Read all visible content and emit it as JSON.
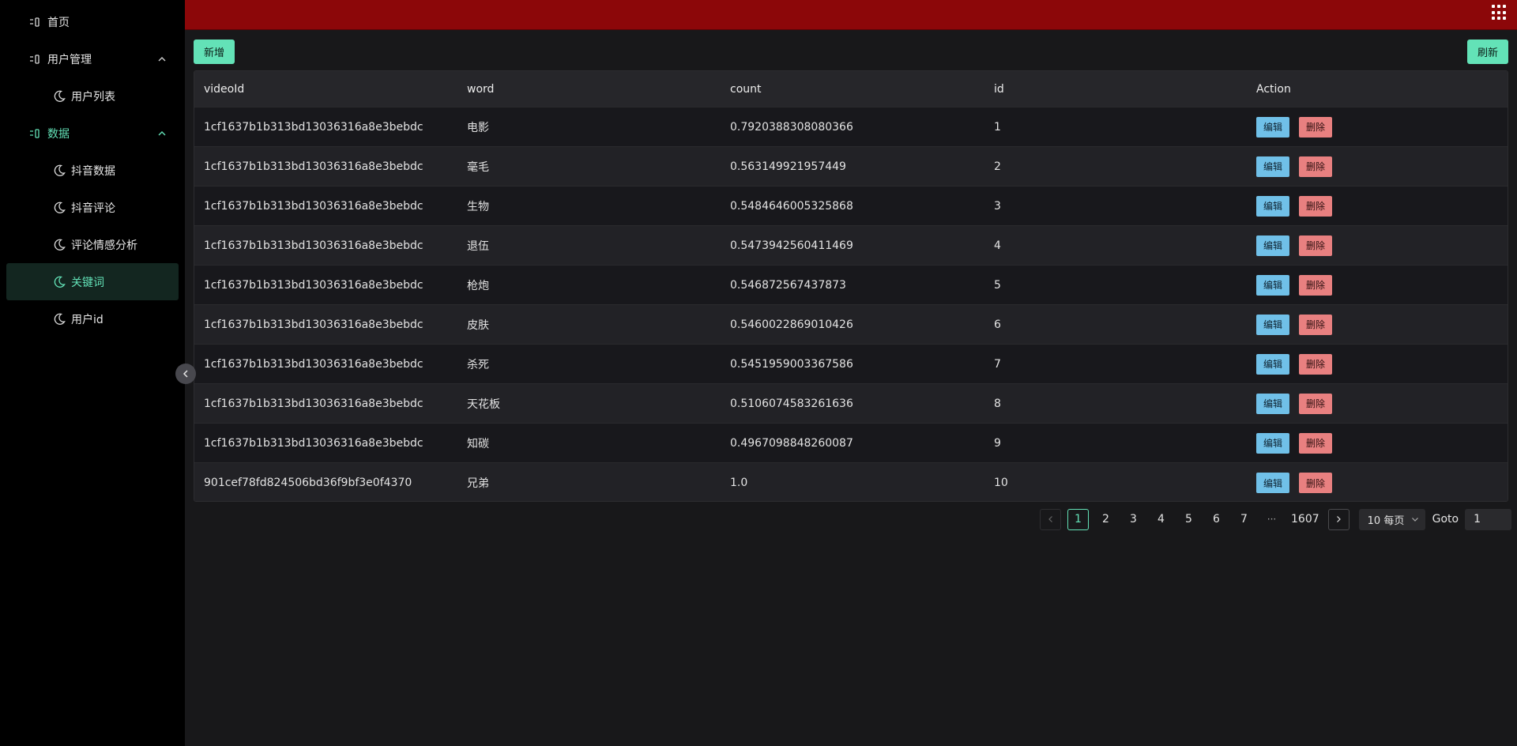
{
  "sidebar": {
    "items": [
      {
        "label": "首页",
        "icon": "menu-icon",
        "level": 0
      },
      {
        "label": "用户管理",
        "icon": "menu-icon",
        "level": 0,
        "expandable": true
      },
      {
        "label": "用户列表",
        "icon": "moon-icon",
        "level": 1
      },
      {
        "label": "数据",
        "icon": "menu-icon",
        "level": 0,
        "expandable": true,
        "open": true
      },
      {
        "label": "抖音数据",
        "icon": "moon-icon",
        "level": 1
      },
      {
        "label": "抖音评论",
        "icon": "moon-icon",
        "level": 1
      },
      {
        "label": "评论情感分析",
        "icon": "moon-icon",
        "level": 1
      },
      {
        "label": "关键词",
        "icon": "moon-icon",
        "level": 1,
        "active": true
      },
      {
        "label": "用户id",
        "icon": "moon-icon",
        "level": 1
      }
    ]
  },
  "toolbar": {
    "add_label": "新增",
    "refresh_label": "刷新"
  },
  "table": {
    "columns": [
      "videoId",
      "word",
      "count",
      "id",
      "Action"
    ],
    "rows": [
      [
        "1cf1637b1b313bd13036316a8e3bebdc",
        "电影",
        "0.7920388308080366",
        "1"
      ],
      [
        "1cf1637b1b313bd13036316a8e3bebdc",
        "毫毛",
        "0.563149921957449",
        "2"
      ],
      [
        "1cf1637b1b313bd13036316a8e3bebdc",
        "生物",
        "0.5484646005325868",
        "3"
      ],
      [
        "1cf1637b1b313bd13036316a8e3bebdc",
        "退伍",
        "0.5473942560411469",
        "4"
      ],
      [
        "1cf1637b1b313bd13036316a8e3bebdc",
        "枪炮",
        "0.546872567437873",
        "5"
      ],
      [
        "1cf1637b1b313bd13036316a8e3bebdc",
        "皮肤",
        "0.5460022869010426",
        "6"
      ],
      [
        "1cf1637b1b313bd13036316a8e3bebdc",
        "杀死",
        "0.5451959003367586",
        "7"
      ],
      [
        "1cf1637b1b313bd13036316a8e3bebdc",
        "天花板",
        "0.5106074583261636",
        "8"
      ],
      [
        "1cf1637b1b313bd13036316a8e3bebdc",
        "知碳",
        "0.4967098848260087",
        "9"
      ],
      [
        "901cef78fd824506bd36f9bf3e0f4370",
        "兄弟",
        "1.0",
        "10"
      ]
    ],
    "edit_label": "编辑",
    "delete_label": "删除"
  },
  "pagination": {
    "pages": [
      "1",
      "2",
      "3",
      "4",
      "5",
      "6",
      "7"
    ],
    "ellipsis": "···",
    "last_page": "1607",
    "current_page": "1",
    "page_size_label": "10 每页",
    "goto_label": "Goto",
    "goto_value": "1"
  },
  "colors": {
    "topbar": "#8c0709",
    "accent": "#63e2b7",
    "edit_button": "#70c0e8",
    "delete_button": "#e88080"
  }
}
